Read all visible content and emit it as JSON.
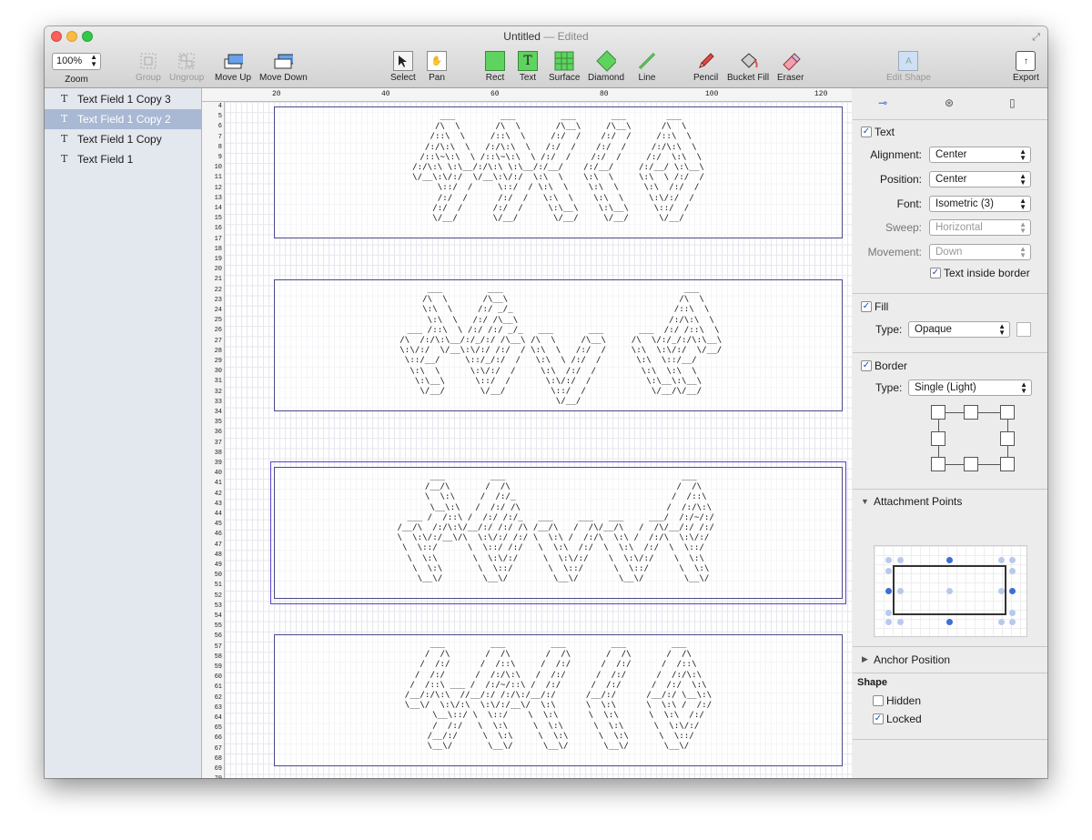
{
  "window": {
    "title": "Untitled",
    "edited": "— Edited"
  },
  "toolbar": {
    "zoom_value": "100%",
    "zoom_label": "Zoom",
    "group": "Group",
    "ungroup": "Ungroup",
    "move_up": "Move Up",
    "move_down": "Move Down",
    "select": "Select",
    "pan": "Pan",
    "rect": "Rect",
    "text": "Text",
    "surface": "Surface",
    "diamond": "Diamond",
    "line": "Line",
    "pencil": "Pencil",
    "bucket_fill": "Bucket Fill",
    "eraser": "Eraser",
    "edit_shape": "Edit Shape",
    "export": "Export",
    "text_icon_glyph": "T",
    "edit_shape_glyph": "A",
    "export_glyph": "↑"
  },
  "layers": [
    {
      "label": "Text Field 1 Copy 3",
      "icon": "T",
      "selected": false
    },
    {
      "label": "Text Field 1 Copy 2",
      "icon": "T",
      "selected": true
    },
    {
      "label": "Text Field 1 Copy",
      "icon": "T",
      "selected": false
    },
    {
      "label": "Text Field 1",
      "icon": "T",
      "selected": false
    }
  ],
  "ruler": {
    "h_labels": [
      "20",
      "40",
      "60",
      "80",
      "100",
      "120"
    ],
    "v_labels": [
      "4",
      "5",
      "6",
      "7",
      "8",
      "9",
      "10",
      "11",
      "12",
      "13",
      "14",
      "15",
      "16",
      "17",
      "18",
      "19",
      "20",
      "21",
      "22",
      "23",
      "24",
      "25",
      "26",
      "27",
      "28",
      "29",
      "30",
      "31",
      "32",
      "33",
      "34",
      "35",
      "36",
      "37",
      "38",
      "39",
      "40",
      "41",
      "42",
      "43",
      "44",
      "45",
      "46",
      "47",
      "48",
      "49",
      "50",
      "51",
      "52",
      "53",
      "54",
      "55",
      "56",
      "57",
      "58",
      "59",
      "60",
      "61",
      "62",
      "63",
      "64",
      "65",
      "66",
      "67",
      "68",
      "69",
      "70"
    ]
  },
  "canvas": {
    "art1": "     ___         ___         ___       ___        ___    \n    /\\  \\       /\\  \\       /\\__\\     /\\__\\      /\\  \\   \n   /::\\  \\     /::\\  \\     /:/  /    /:/  /     /::\\  \\  \n  /:/\\:\\  \\   /:/\\:\\  \\   /:/  /    /:/  /     /:/\\:\\  \\ \n /::\\~\\:\\  \\ /::\\~\\:\\  \\ /:/  /    /:/  /     /:/  \\:\\  \\\n/:/\\:\\ \\:\\__/:/\\:\\ \\:\\__/:/__/    /:/__/     /:/__/ \\:\\__\\\n\\/__\\:\\/:/  \\/__\\:\\/:/  \\:\\  \\    \\:\\  \\     \\:\\  \\ /:/  /\n     \\::/  /     \\::/  / \\:\\  \\    \\:\\  \\     \\:\\  /:/  / \n     /:/  /      /:/  /   \\:\\  \\    \\:\\  \\     \\:\\/:/  /  \n    /:/  /      /:/  /     \\:\\__\\    \\:\\__\\     \\::/  /   \n    \\/__/       \\/__/       \\/__/     \\/__/      \\/__/    ",
    "art2": "      ___         ___                                    ___    \n     /\\  \\       /\\__\\                                  /\\  \\   \n     \\:\\  \\     /:/ _/_                                /::\\  \\  \n      \\:\\  \\   /:/ /\\__\\                              /:/\\:\\  \\ \n  ___ /::\\  \\ /:/ /:/ _/_   ___       ___       ___  /:/ /::\\  \\\n /\\  /:/\\:\\__/:/_/:/ /\\__\\ /\\  \\     /\\__\\     /\\  \\/:/_/:/\\:\\__\\\n \\:\\/:/  \\/__\\:\\/:/ /:/  / \\:\\  \\   /:/  /     \\:\\  \\:\\/:/  \\/__/\n  \\::/__/     \\::/_/:/  /   \\:\\  \\ /:/  /       \\:\\  \\::/__/     \n   \\:\\  \\      \\:\\/:/  /     \\:\\  /:/  /         \\:\\  \\:\\  \\     \n    \\:\\__\\      \\::/  /       \\:\\/:/  /           \\:\\__\\:\\__\\    \n     \\/__/       \\/__/         \\::/  /             \\/__/\\/__/    \n                                \\/__/                            ",
    "art3": "     ___         ___                                   ___   \n    /__/\\       /  /\\                                 /  /\\  \n    \\  \\:\\     /  /:/_                               /  /::\\ \n     \\__\\:\\   /  /:/ /\\                             /  /:/\\:\\\n ___ /  /::\\ /  /:/ /:/_   ___     ___   ___     ___/  /:/~/:/\n/__/\\  /:/\\:\\/__/:/ /:/ /\\ /__/\\   /  /\\/__/\\   /  /\\/__/:/ /:/ \n\\  \\:\\/:/__\\/\\  \\:\\/:/ /:/ \\  \\:\\ /  /:/\\  \\:\\ /  /:/\\  \\:\\/:/  \n \\  \\::/      \\  \\::/ /:/   \\  \\:\\  /:/  \\  \\:\\  /:/  \\  \\::/   \n  \\  \\:\\       \\  \\:\\/:/     \\  \\:\\/:/    \\  \\:\\/:/    \\  \\:\\   \n   \\  \\:\\       \\  \\::/       \\  \\::/      \\  \\::/      \\  \\:\\  \n    \\__\\/        \\__\\/         \\__\\/        \\__\\/        \\__\\/  ",
    "art4": "     ___         ___         ___         ___         ___     \n    /  /\\       /  /\\       /  /\\       /  /\\       /  /\\    \n   /  /:/      /  /::\\     /  /:/      /  /:/      /  /::\\   \n  /  /:/      /  /:/\\:\\   /  /:/      /  /:/      /  /:/\\:\\  \n /  /::\\ ___ /  /:/~/::\\ /  /:/      /  /:/      /  /:/  \\:\\ \n/__/:/\\:\\  //__/:/ /:/\\:/__/:/      /__/:/      /__/:/ \\__\\:\\\n\\__\\/  \\:\\/:\\  \\:\\/:/__\\/  \\:\\      \\  \\:\\      \\  \\:\\ /  /:/\n     \\__\\::/ \\  \\::/    \\  \\:\\      \\  \\:\\      \\  \\:\\  /:/ \n     /  /:/   \\  \\:\\     \\  \\:\\      \\  \\:\\      \\  \\:\\/:/  \n    /__/:/     \\  \\:\\     \\  \\:\\      \\  \\:\\      \\  \\::/   \n    \\__\\/       \\__\\/      \\__\\/       \\__\\/       \\__\\/    "
  },
  "inspector": {
    "text": {
      "label": "Text",
      "checked": true,
      "alignment_label": "Alignment:",
      "alignment_value": "Center",
      "position_label": "Position:",
      "position_value": "Center",
      "font_label": "Font:",
      "font_value": "Isometric (3)",
      "sweep_label": "Sweep:",
      "sweep_value": "Horizontal",
      "movement_label": "Movement:",
      "movement_value": "Down",
      "inside_border_label": "Text inside border",
      "inside_border_checked": true
    },
    "fill": {
      "label": "Fill",
      "checked": true,
      "type_label": "Type:",
      "type_value": "Opaque",
      "swatch_color": "#ffffff"
    },
    "border": {
      "label": "Border",
      "checked": true,
      "type_label": "Type:",
      "type_value": "Single (Light)"
    },
    "attachment_points_label": "Attachment Points",
    "anchor_position_label": "Anchor Position",
    "shape": {
      "label": "Shape",
      "hidden_label": "Hidden",
      "hidden_checked": false,
      "locked_label": "Locked",
      "locked_checked": true
    }
  },
  "colors": {
    "selection": "#a9b8d3",
    "frame_border": "#4a4a88",
    "selection_ring": "#5b3fcf",
    "green_tool": "#5fd35f"
  }
}
